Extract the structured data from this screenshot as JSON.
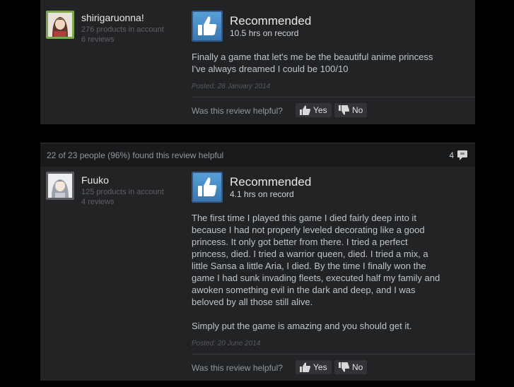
{
  "reviews": [
    {
      "helpful_summary": "",
      "comment_count": "",
      "user": {
        "name": "shirigaruonna!",
        "products": "276 products in account",
        "reviews": "6 reviews"
      },
      "verdict": "Recommended",
      "hours": "10.5 hrs on record",
      "text": "Finally a game that let's me be the beautiful anime princess\nI've always dreamed I could be 100/10",
      "posted": "Posted: 28 January 2014",
      "helpful_question": "Was this review helpful?",
      "yes_label": "Yes",
      "no_label": "No"
    },
    {
      "helpful_summary": "22 of 23 people (96%) found this review helpful",
      "comment_count": "4",
      "user": {
        "name": "Fuuko",
        "products": "125 products in account",
        "reviews": "4 reviews"
      },
      "verdict": "Recommended",
      "hours": "4.1 hrs on record",
      "text": "The first time I played this game I died fairly deep into it\nbecause I had not properly leveled decorating like a good\nprincess. It only got better from there. I tried a perfect\nprincess, died. I tried a warrior queen, died. I tried a mix, a\nlittle Sansa a little Aria, I died. By the time I finally won the\ngame I had sunk invading fleets, executed half my family and\nawoken something evil in the dark and deep, and I was\nbeloved by all those still alive.\n\nSimply put the game is amazing and you should get it.",
      "posted": "Posted: 20 June 2014",
      "helpful_question": "Was this review helpful?",
      "yes_label": "Yes",
      "no_label": "No"
    }
  ],
  "colors": {
    "page_bg": "#000000",
    "card_bg": "#222325",
    "thumb_blue": "#4a8cc6",
    "avatar_green": "#7ea64b"
  },
  "icons": {
    "thumb": "thumbs-up-icon",
    "yes": "thumbs-up-icon",
    "no": "thumbs-down-icon",
    "comments": "speech-bubble-icon"
  }
}
